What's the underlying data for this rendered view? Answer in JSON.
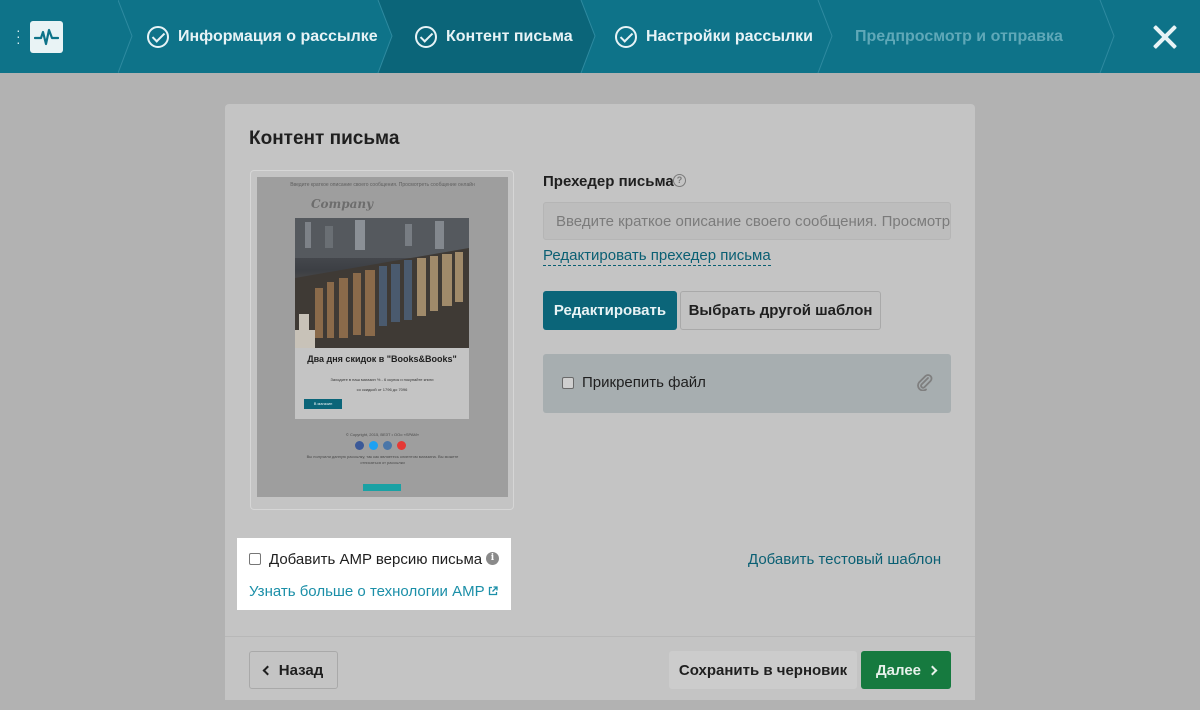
{
  "nav": {
    "steps": [
      {
        "label": "Информация о рассылке",
        "state": "done"
      },
      {
        "label": "Контент письма",
        "state": "active"
      },
      {
        "label": "Настройки рассылки",
        "state": "done"
      },
      {
        "label": "Предпросмотр и отправка",
        "state": "disabled"
      }
    ],
    "logo_icon": "pulse-icon",
    "close_icon": "close-icon"
  },
  "content": {
    "title": "Контент письма",
    "preheader_label": "Прехедер письма",
    "preheader_placeholder": "Введите краткое описание своего сообщения. Просмотр",
    "edit_preheader_link": "Редактировать прехедер письма",
    "edit_button": "Редактировать",
    "choose_template_button": "Выбрать другой шаблон",
    "attach_label": "Прикрепить файл",
    "add_test_template": "Добавить тестовый шаблон",
    "amp_label": "Добавить AMP версию письма",
    "amp_learn_more": "Узнать больше о технологии AMP"
  },
  "preview": {
    "top_line": "Введите краткое описание своего сообщения. Просмотреть сообщение онлайн",
    "company": "Company",
    "headline": "Два дня скидок в \"Books&Books\"",
    "sub1": "Заходите в наш магазин % - 6 скупок и покупайте книги",
    "sub2": "со скидкой от 1796 до 7096",
    "button": "В магазин",
    "copyright": "© Copyright, 2015, ВЕЗТ • ООо «SPAM»",
    "note": "Вы получили данную рассылку, так как являетесь клиентом магазина. Вы можете отписаться от рассылки",
    "social": [
      "#3b5998",
      "#1da1f2",
      "#4a76a8",
      "#e53935"
    ]
  },
  "footer": {
    "back": "Назад",
    "save_draft": "Сохранить в черновик",
    "next": "Далее"
  },
  "colors": {
    "topbar": "#0e7389",
    "primary": "#0b6579",
    "success": "#167a3f",
    "link": "#1b8fa8"
  }
}
